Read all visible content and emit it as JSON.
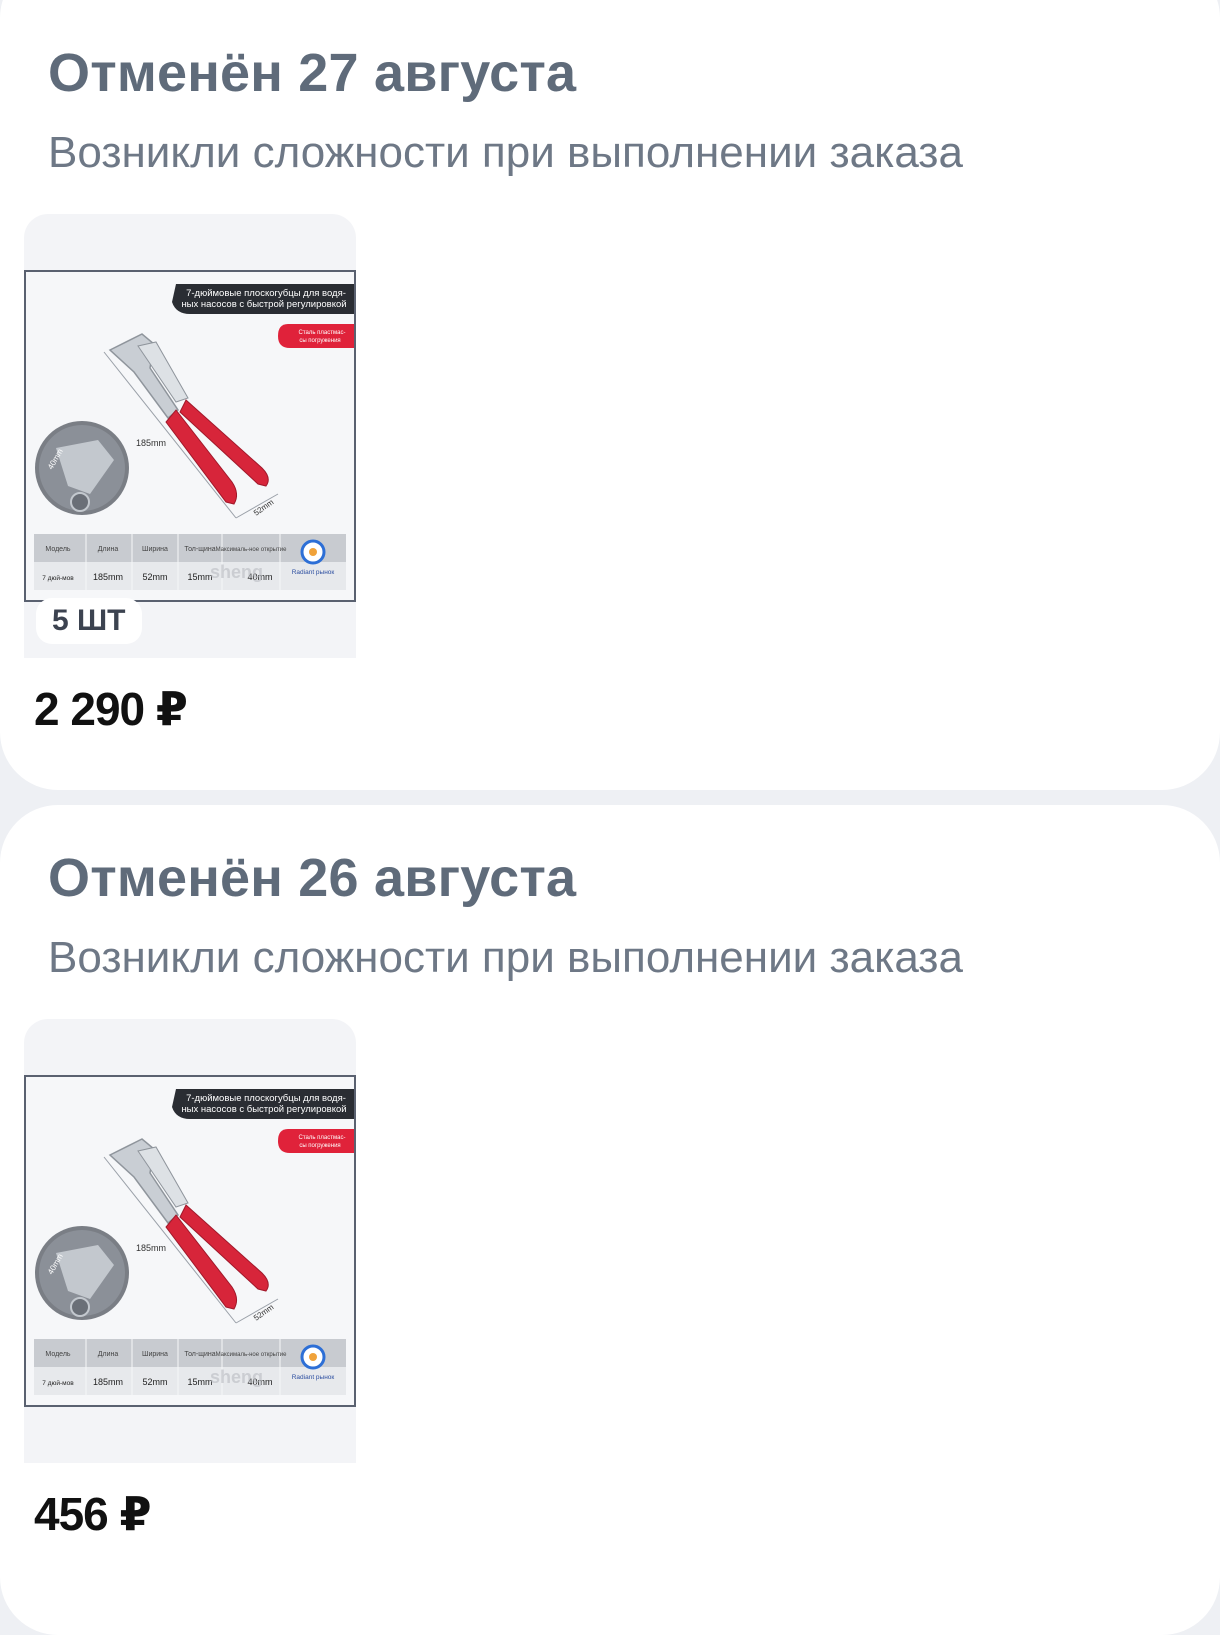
{
  "orders": [
    {
      "title": "Отменён 27 августа",
      "reason": "Возникли сложности при выполнении заказа",
      "quantity": "5 ШТ",
      "price": "2 290 ₽",
      "image": {
        "banner_line1": "7-дюймовые плоскогубцы для водя-",
        "banner_line2": "ных насосов с быстрой регулировкой",
        "red_tag_line1": "Сталь пластмас-",
        "red_tag_line2": "сы погружения",
        "dim_length": "185mm",
        "dim_width": "52mm",
        "dim_jaw": "40mm",
        "table_headers": [
          "Модель",
          "Длина",
          "Ширина",
          "Тол-щина",
          "Максималь-ное открытие"
        ],
        "table_values": [
          "7 дюй-мов",
          "185mm",
          "52mm",
          "15mm",
          "40mm"
        ],
        "watermark": "sheng",
        "brand": "Radiant рынок"
      }
    },
    {
      "title": "Отменён 26 августа",
      "reason": "Возникли сложности при выполнении заказа",
      "quantity": "",
      "price": "456 ₽",
      "image": {
        "banner_line1": "7-дюймовые плоскогубцы для водя-",
        "banner_line2": "ных насосов с быстрой регулировкой",
        "red_tag_line1": "Сталь пластмас-",
        "red_tag_line2": "сы погружения",
        "dim_length": "185mm",
        "dim_width": "52mm",
        "dim_jaw": "40mm",
        "table_headers": [
          "Модель",
          "Длина",
          "Ширина",
          "Тол-щина",
          "Максималь-ное открытие"
        ],
        "table_values": [
          "7 дюй-мов",
          "185mm",
          "52mm",
          "15mm",
          "40mm"
        ],
        "watermark": "sheng",
        "brand": "Radiant рынок"
      }
    }
  ]
}
